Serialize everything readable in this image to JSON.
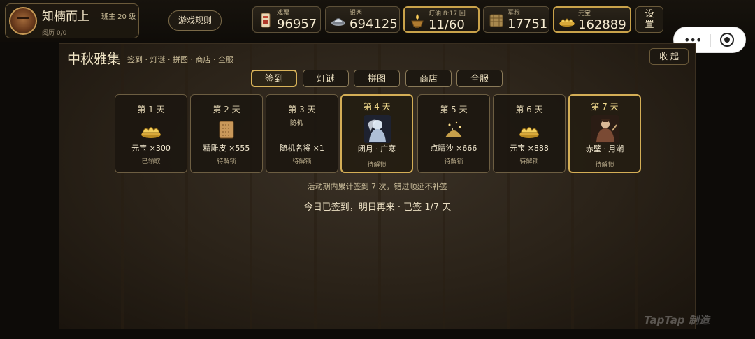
{
  "player": {
    "name": "知楠而上",
    "level": "班主 20 级",
    "experience": "阅历 0/0"
  },
  "rules_button": "游戏规则",
  "resources": [
    {
      "label": "戏票",
      "value": "96957",
      "icon": "ticket-icon"
    },
    {
      "label": "银两",
      "value": "694125",
      "icon": "silver-icon"
    },
    {
      "label": "灯油 8:17 回",
      "value": "11/60",
      "icon": "lamp-oil-icon"
    },
    {
      "label": "军粮",
      "value": "17751",
      "icon": "grain-icon"
    },
    {
      "label": "元宝",
      "value": "162889",
      "icon": "ingot-icon"
    }
  ],
  "settings_button": "设置",
  "event": {
    "title": "中秋雅集",
    "subtitle": "签到 · 灯谜 · 拼图 · 商店 · 全服",
    "collapse_button": "收 起",
    "tabs": [
      "签到",
      "灯谜",
      "拼图",
      "商店",
      "全服"
    ],
    "active_tab": "签到",
    "days": [
      {
        "label": "第 1 天",
        "reward": "元宝 ×300",
        "status": "已领取",
        "icon": "ingot-icon"
      },
      {
        "label": "第 2 天",
        "reward": "精雕皮 ×555",
        "status": "待解锁",
        "icon": "carved-leather-icon"
      },
      {
        "label": "第 3 天",
        "reward": "随机名将 ×1",
        "status": "待解锁",
        "tag": "随机",
        "icon": "random-general-icon"
      },
      {
        "label": "第 4 天",
        "reward": "闭月 · 广寒",
        "status": "待解锁",
        "icon": "moon-lady-portrait-icon"
      },
      {
        "label": "第 5 天",
        "reward": "点睛沙 ×666",
        "status": "待解锁",
        "icon": "golden-sand-icon"
      },
      {
        "label": "第 6 天",
        "reward": "元宝 ×888",
        "status": "待解锁",
        "icon": "ingot-icon"
      },
      {
        "label": "第 7 天",
        "reward": "赤壁 · 月潮",
        "status": "待解锁",
        "icon": "red-cliff-portrait-icon"
      }
    ],
    "notice": "活动期内累计签到 7 次，错过顺延不补签",
    "checkin_status": "今日已签到，明日再来 · 已签 1/7 天"
  },
  "watermark": "TapTap 制造",
  "colors": {
    "accent_gold": "#d4ae56",
    "panel_bg": "#2a2218",
    "text_light": "#f3e7c7"
  }
}
